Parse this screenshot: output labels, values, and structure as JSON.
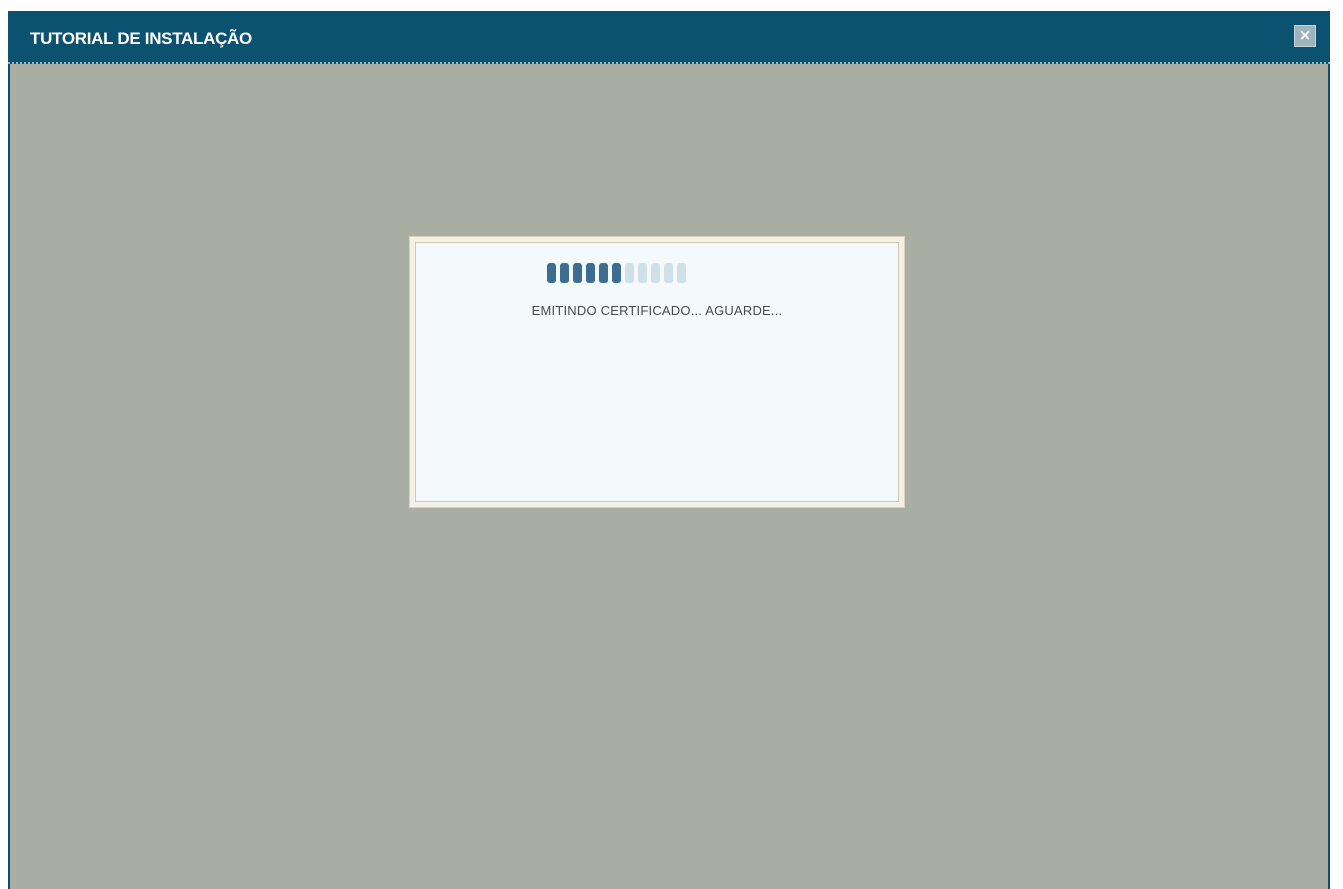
{
  "window": {
    "title": "TUTORIAL DE INSTALAÇÃO",
    "close_label": "×"
  },
  "loading": {
    "message": "EMITINDO CERTIFICADO... AGUARDE...",
    "progress": {
      "total_segments": 11,
      "filled_segments": 6
    }
  },
  "colors": {
    "title_bar": "#0b5270",
    "content_background": "#aaada2",
    "progress_filled": "#3d6e92",
    "progress_empty": "#cfe0e6"
  }
}
